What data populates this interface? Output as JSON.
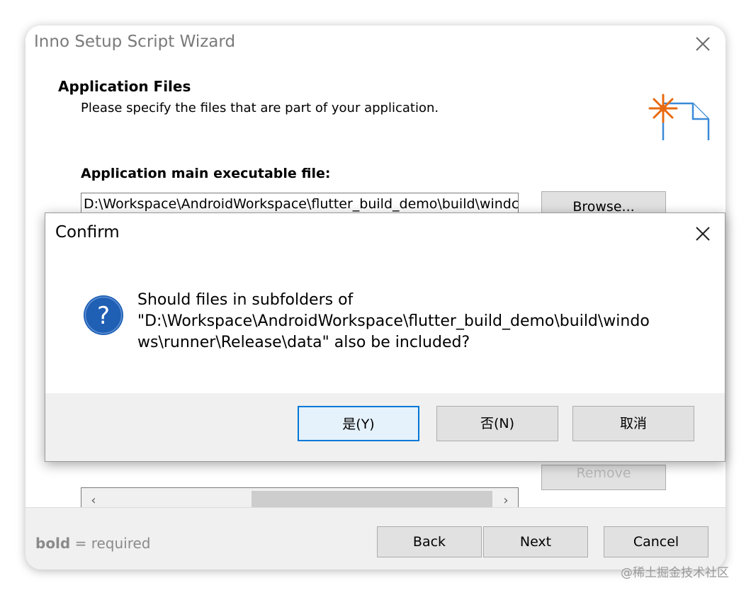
{
  "wizard": {
    "title": "Inno Setup Script Wizard",
    "header_title": "Application Files",
    "header_subtitle": "Please specify the files that are part of your application.",
    "exe_label": "Application main executable file:",
    "exe_value": "D:\\Workspace\\AndroidWorkspace\\flutter_build_demo\\build\\windc",
    "browse_label": "Browse...",
    "remove_label": "Remove",
    "scroll_left": "‹",
    "scroll_right": "›",
    "footer_bold": "bold",
    "footer_note": " = required",
    "back_label": "Back",
    "next_label": "Next",
    "cancel_label": "Cancel"
  },
  "confirm": {
    "title": "Confirm",
    "message_lines": [
      "Should files in subfolders of",
      "\"D:\\Workspace\\AndroidWorkspace\\flutter_build_demo\\build\\windo",
      "ws\\runner\\Release\\data\" also be included?"
    ],
    "yes_label": "是(Y)",
    "no_label": "否(N)",
    "cancel_label": "取消"
  },
  "watermark": "@稀土掘金技术社区",
  "colors": {
    "accent": "#0078d7",
    "question_icon": "#1f5fb4",
    "header_icon_star": "#e86a10",
    "header_icon_doc": "#3a8ad8"
  }
}
